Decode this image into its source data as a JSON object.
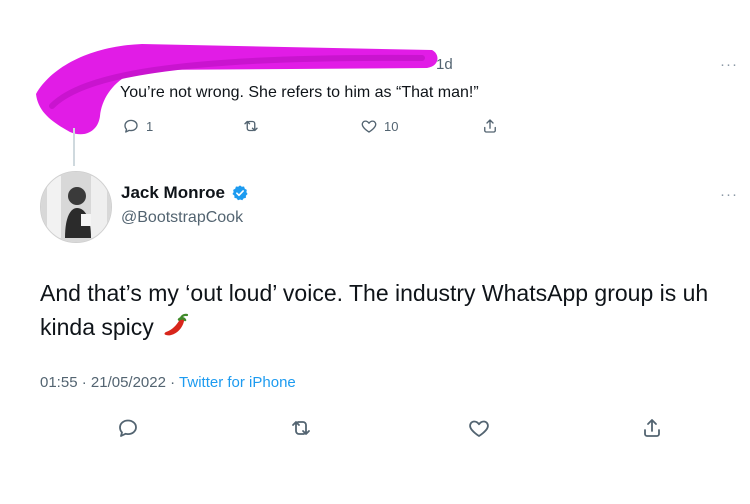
{
  "reply": {
    "age": "1d",
    "text": "You’re not wrong. She refers to him as “That man!”",
    "more": "···",
    "reply_count": "1",
    "retweet_count": "",
    "like_count": "10"
  },
  "tweet": {
    "name": "Jack Monroe",
    "handle": "@BootstrapCook",
    "text": "And that’s my ‘out loud’ voice. The industry WhatsApp group is uh kinda spicy",
    "emoji": "chili-pepper",
    "time": "01:55",
    "date": "21/05/2022",
    "separator": " · ",
    "source": "Twitter for iPhone",
    "more": "···"
  },
  "colors": {
    "text": "#0f1419",
    "muted": "#536471",
    "link": "#1d9bf0",
    "redaction": "#e11ce6"
  }
}
